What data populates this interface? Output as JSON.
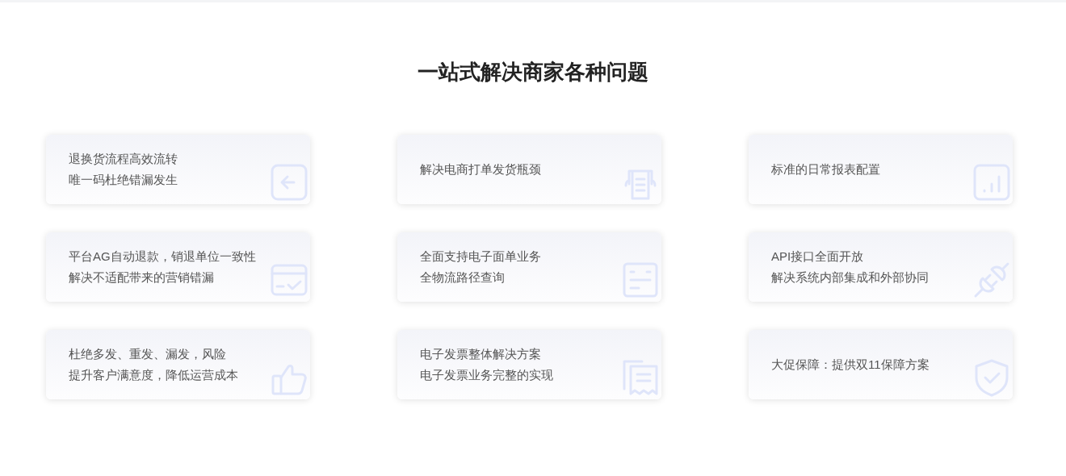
{
  "title": "一站式解决商家各种问题",
  "cards": [
    {
      "lines": [
        "退换货流程高效流转",
        "唯一码杜绝错漏发生"
      ]
    },
    {
      "lines": [
        "解决电商打单发货瓶颈"
      ]
    },
    {
      "lines": [
        "标准的日常报表配置"
      ]
    },
    {
      "lines": [
        "平台AG自动退款，销退单位一致性",
        "解决不适配带来的营销错漏"
      ]
    },
    {
      "lines": [
        "全面支持电子面单业务",
        "全物流路径查询"
      ]
    },
    {
      "lines": [
        "API接口全面开放",
        "解决系统内部集成和外部协同"
      ]
    },
    {
      "lines": [
        "杜绝多发、重发、漏发，风险",
        "提升客户满意度，降低运营成本"
      ]
    },
    {
      "lines": [
        "电子发票整体解决方案",
        "电子发票业务完整的实现"
      ]
    },
    {
      "lines": [
        "大促保障：提供双11保障方案"
      ]
    }
  ]
}
